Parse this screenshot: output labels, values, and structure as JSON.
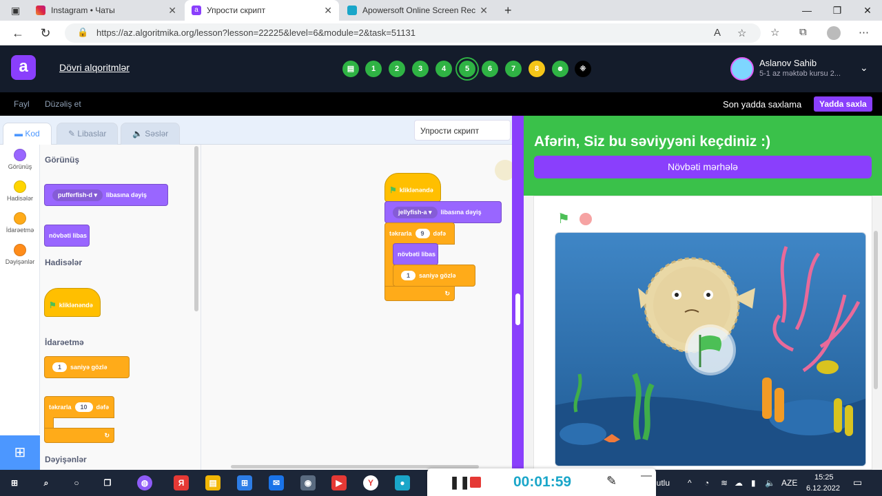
{
  "browser": {
    "tabs": [
      {
        "label": "Instagram • Чаты",
        "close": "✕"
      },
      {
        "label": "Упрости скрипт",
        "close": "✕"
      },
      {
        "label": "Apowersoft Online Screen Recor",
        "close": "✕"
      }
    ],
    "new_tab": "+",
    "url": "https://az.algoritmika.org/lesson?lesson=22225&level=6&module=2&task=51131"
  },
  "header": {
    "logo": "a",
    "lesson_title": "Dövri alqoritmlər",
    "steps": [
      "1",
      "2",
      "3",
      "4",
      "5",
      "6",
      "7",
      "8"
    ],
    "user_name": "Aslanov Sahib",
    "user_sub": "5-1 az məktəb kursu 2..."
  },
  "menu": {
    "file": "Fayl",
    "edit": "Düzəliş et",
    "saved_status": "Son yadda saxlama",
    "save_button": "Yadda saxla"
  },
  "editor": {
    "tabs": [
      "Kod",
      "Libaslar",
      "Səslər"
    ],
    "project_title": "Упрости скрипт",
    "categories": [
      {
        "label": "Görünüş",
        "color": "#9966ff"
      },
      {
        "label": "Hadisələr",
        "color": "#ffd500"
      },
      {
        "label": "İdarəetmə",
        "color": "#ffab19"
      },
      {
        "label": "Dəyişənlər",
        "color": "#ff8c1a"
      }
    ],
    "palette": {
      "looks_title": "Görünüş",
      "switch_costume_value": "pufferfish-d",
      "switch_costume_label": "libasına dəyiş",
      "next_costume": "növbəti libas",
      "events_title": "Hadisələr",
      "when_flag": "kliklənəndə",
      "control_title": "İdarəetmə",
      "wait_value": "1",
      "wait_label": "saniyə gözlə",
      "repeat_label": "təkrarla",
      "repeat_value": "10",
      "repeat_suffix": "dəfə",
      "variables_title": "Dəyişənlər"
    },
    "script": {
      "when_flag": "kliklənəndə",
      "switch_costume_value": "jellyfish-a",
      "switch_costume_label": "libasına dəyiş",
      "repeat_label": "təkrarla",
      "repeat_value": "9",
      "repeat_suffix": "dəfə",
      "next_costume": "növbəti libas",
      "wait_value": "1",
      "wait_label": "saniyə gözlə"
    }
  },
  "stage": {
    "success_message": "Afərin, Siz bu səviyyəni keçdiniz :)",
    "next_button": "Növbəti mərhələ"
  },
  "recorder": {
    "timer": "00:01:59"
  },
  "taskbar": {
    "weather": "lutlu",
    "lang": "AZE",
    "time": "15:25",
    "date": "6.12.2022"
  }
}
